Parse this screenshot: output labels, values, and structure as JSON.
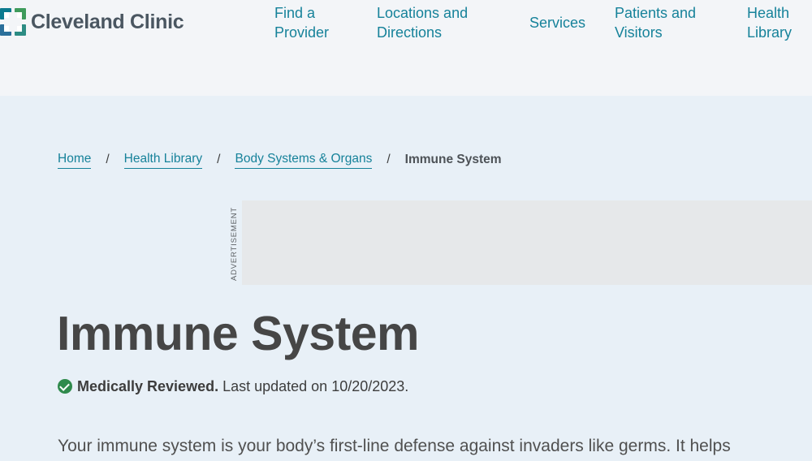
{
  "header": {
    "brand_name": "Cleveland Clinic",
    "brand_color": "#00829b",
    "logo_colors": [
      "#0b6e8a",
      "#3a9a5b",
      "#1d4e89",
      "#48a999"
    ],
    "nav": [
      {
        "label": "Find a\nProvider"
      },
      {
        "label": "Locations and\nDirections"
      },
      {
        "label": "Services"
      },
      {
        "label": "Patients and\nVisitors"
      },
      {
        "label": "Health\nLibrary"
      }
    ]
  },
  "breadcrumb": {
    "items": [
      {
        "label": "Home"
      },
      {
        "label": "Health Library"
      },
      {
        "label": "Body Systems & Organs"
      }
    ],
    "separator": "/",
    "current": "Immune System"
  },
  "advertisement": {
    "label": "ADVERTISEMENT"
  },
  "article": {
    "title": "Immune System",
    "review_status": "Medically Reviewed.",
    "last_updated": "Last updated on 10/20/2023.",
    "status_color": "#2f8a4c",
    "intro": "Your immune system is your body’s first-line defense against invaders like germs. It helps"
  },
  "icons": {
    "logo": "cleveland-clinic-cross-icon",
    "review": "check-circle-icon"
  }
}
